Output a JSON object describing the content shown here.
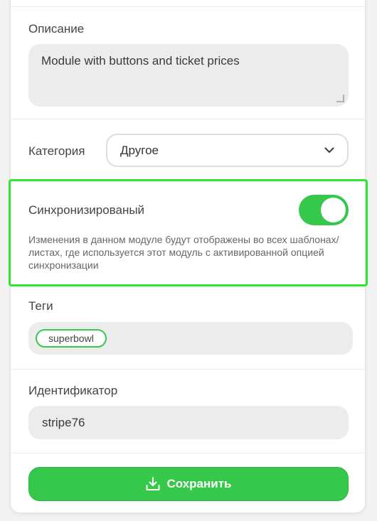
{
  "description": {
    "label": "Описание",
    "value": "Module with buttons and ticket prices"
  },
  "category": {
    "label": "Категория",
    "selected": "Другое",
    "chevron_icon": "chevron-down-icon"
  },
  "sync": {
    "label": "Синхронизированый",
    "enabled": true,
    "description": "Изменения в данном модуле будут отображены во всех шаблонах/листах, где используется этот модуль с активированной опцией синхронизации",
    "highlight_color": "#2ee82e"
  },
  "tags": {
    "label": "Теги",
    "items": [
      "superbowl"
    ]
  },
  "identifier": {
    "label": "Идентификатор",
    "value": "stripe76"
  },
  "save": {
    "label": "Сохранить",
    "icon": "download-icon",
    "color": "#35c84a"
  }
}
